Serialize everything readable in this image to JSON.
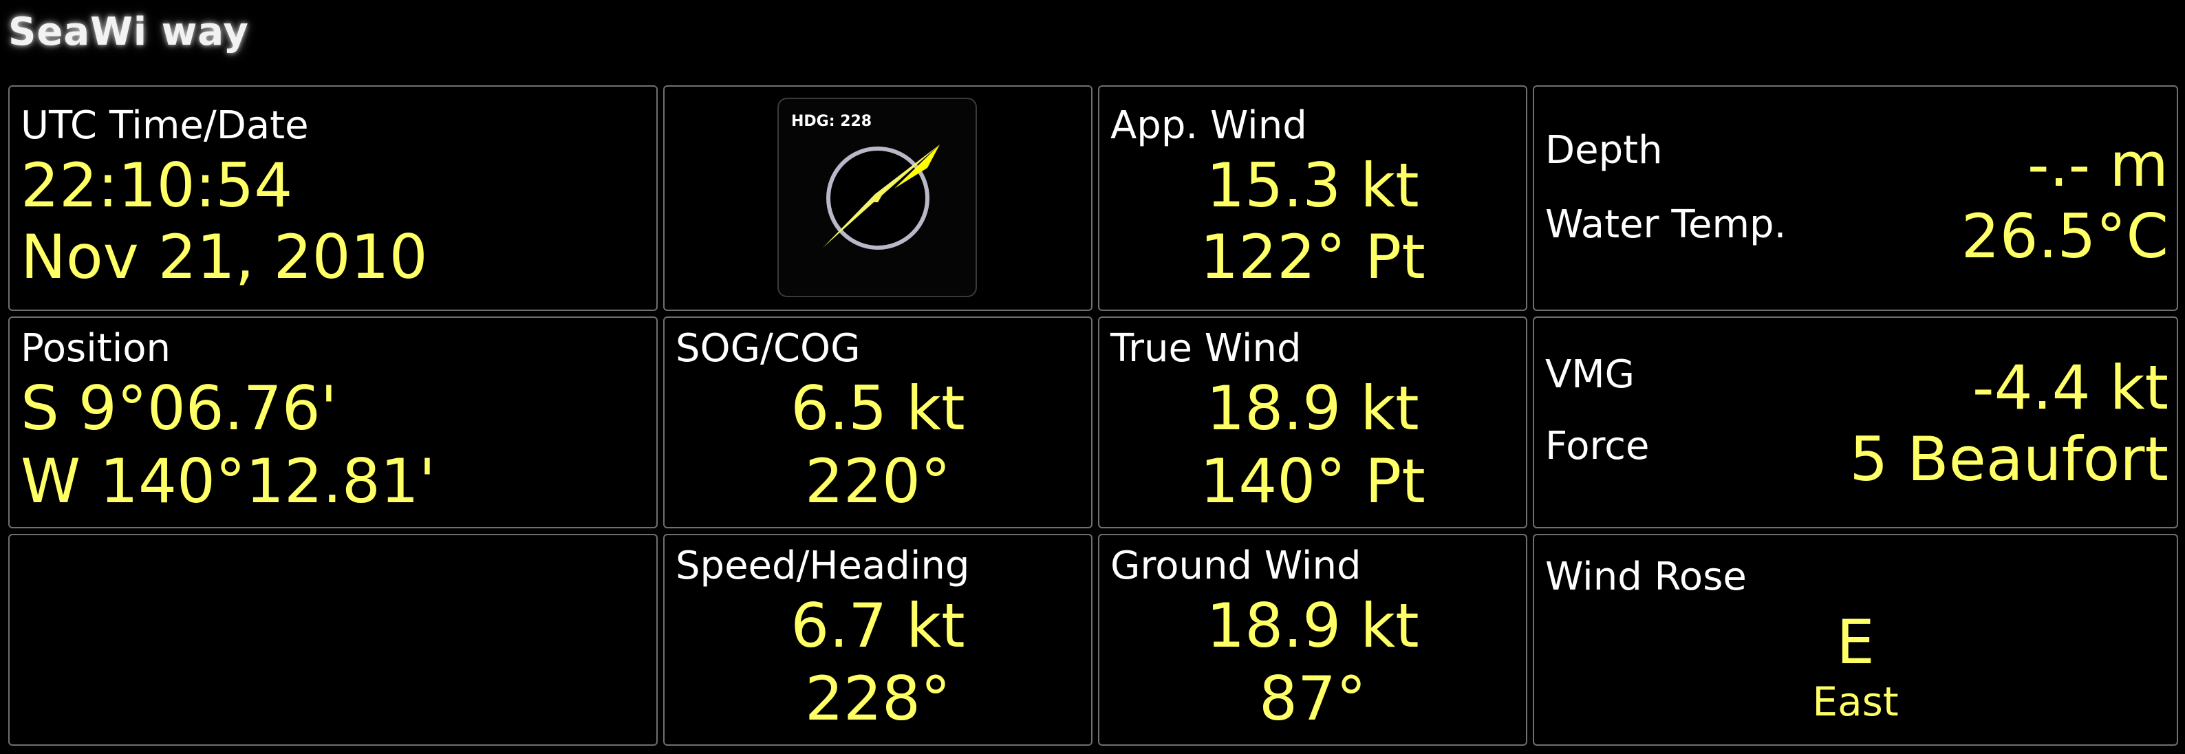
{
  "app": {
    "title": "SeaWi way"
  },
  "colors": {
    "value": "#ffff66",
    "label": "#ffffff",
    "border": "#6f6f6f",
    "background": "#000000"
  },
  "time": {
    "label": "UTC Time/Date",
    "time": "22:10:54",
    "date": "Nov 21, 2010"
  },
  "compass": {
    "hdg_label": "HDG: 228",
    "heading_deg": 228,
    "icon": "compass-needle-icon"
  },
  "app_wind": {
    "label": "App. Wind",
    "speed": "15.3 kt",
    "angle": "122° Pt"
  },
  "depth": {
    "label": "Depth",
    "value": "-.- m"
  },
  "water_temp": {
    "label": "Water Temp.",
    "value": "26.5°C"
  },
  "position": {
    "label": "Position",
    "lat": "S 9°06.76'",
    "lon": "W 140°12.81'"
  },
  "sog_cog": {
    "label": "SOG/COG",
    "sog": "6.5 kt",
    "cog": "220°"
  },
  "true_wind": {
    "label": "True Wind",
    "speed": "18.9 kt",
    "angle": "140° Pt"
  },
  "vmg": {
    "label": "VMG",
    "value": "-4.4 kt"
  },
  "force": {
    "label": "Force",
    "value": "5 Beaufort"
  },
  "speed_heading": {
    "label": "Speed/Heading",
    "speed": "6.7 kt",
    "heading": "228°"
  },
  "ground_wind": {
    "label": "Ground Wind",
    "speed": "18.9 kt",
    "direction": "87°"
  },
  "wind_rose": {
    "label": "Wind Rose",
    "abbr": "E",
    "name": "East"
  }
}
